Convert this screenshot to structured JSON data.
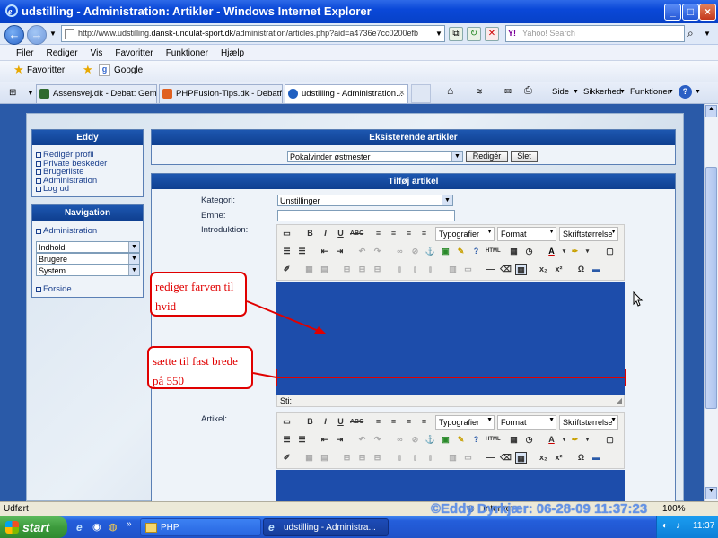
{
  "window": {
    "title": "udstilling - Administration: Artikler - Windows Internet Explorer"
  },
  "address": {
    "url_prefix": "http://www.udstilling.",
    "url_domain": "dansk-undulat-sport.dk",
    "url_suffix": "/administration/articles.php?aid=a4736e7cc0200efb",
    "search_placeholder": "Yahoo! Search"
  },
  "menu": [
    "Filer",
    "Rediger",
    "Vis",
    "Favoritter",
    "Funktioner",
    "Hjælp"
  ],
  "favorites": {
    "label": "Favoritter",
    "google": "Google"
  },
  "tabs": [
    {
      "label": "Assensvej.dk - Debat: Gem i...",
      "color": "#2f6a2f"
    },
    {
      "label": "PHPFusion-Tips.dk - Debatfo...",
      "color": "#e06020"
    },
    {
      "label": "udstilling - Administration...",
      "color": "#1f5fc0"
    }
  ],
  "commandbar": {
    "side": "Side",
    "sikkerhed": "Sikkerhed",
    "funktioner": "Funktioner"
  },
  "sidebar": {
    "user_box": {
      "title": "Eddy",
      "links": [
        "Redigér profil",
        "Private beskeder",
        "Brugerliste",
        "Administration",
        "Log ud"
      ]
    },
    "nav_box": {
      "title": "Navigation",
      "admin_link": "Administration",
      "selects": [
        "Indhold",
        "Brugere",
        "System"
      ],
      "home_link": "Forside"
    }
  },
  "existing": {
    "title": "Eksisterende artikler",
    "selected": "Pokalvinder østmester",
    "edit_button": "Redigér",
    "delete_button": "Slet"
  },
  "add": {
    "title": "Tilføj artikel",
    "category_label": "Kategori:",
    "category_value": "Unstillinger",
    "subject_label": "Emne:",
    "intro_label": "Introduktion:",
    "article_label": "Artikel:",
    "typography_select": "Typografier",
    "format_select": "Format",
    "fontsize_select": "Skriftstørrelse",
    "path_label": "Sti:"
  },
  "annotations": {
    "color_note": "rediger farven til hvid",
    "width_note": "sætte til fast brede på 550"
  },
  "colors": {
    "annotation": "#e00000",
    "editor_bg": "#1d4dab"
  },
  "status": {
    "left": "Udført",
    "zone": "Internet",
    "zoom": "100%"
  },
  "taskbar": {
    "start": "start",
    "items": [
      "PHP",
      "udstilling - Administra..."
    ],
    "clock": "11:37"
  },
  "watermark": "©Eddy Dyrkjær: 06-28-09 11:37:23"
}
